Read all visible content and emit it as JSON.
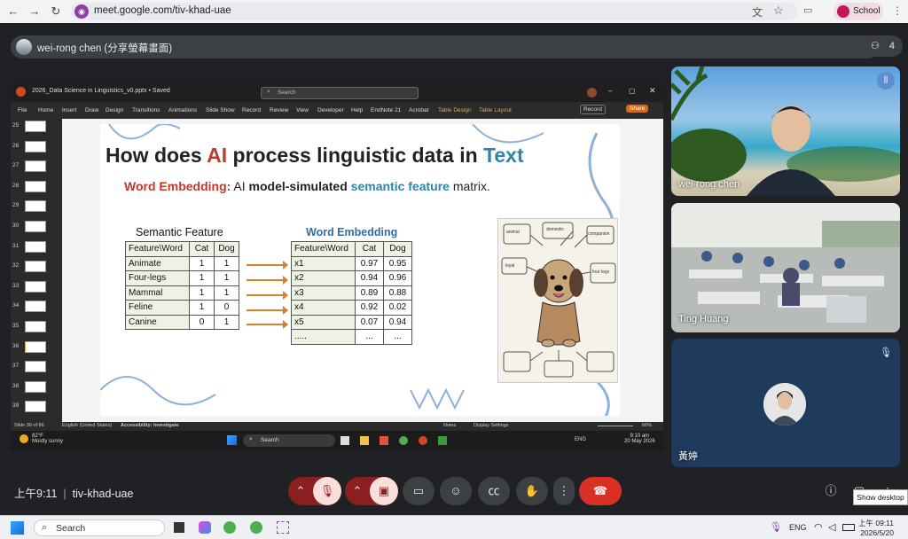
{
  "browser": {
    "url": "meet.google.com/tiv-khad-uae",
    "profile": "School"
  },
  "meet": {
    "presenter_label": "wei-rong chen (分享螢幕畫面)",
    "participant_count": "4",
    "time": "上午9:11",
    "meeting_code": "tiv-khad-uae",
    "tooltip": "Show desktop"
  },
  "participants": [
    {
      "name": "wei-rong chen"
    },
    {
      "name": "Ting Huang"
    },
    {
      "name": "黃婷"
    }
  ],
  "shared": {
    "file": "2026_Data Science in Linguistics_v0.pptx • Saved",
    "search_placeholder": "Search",
    "ribbon": [
      "File",
      "Home",
      "Insert",
      "Draw",
      "Design",
      "Transitions",
      "Animations",
      "Slide Show",
      "Record",
      "Review",
      "View",
      "Developer",
      "Help",
      "EndNote 21",
      "Acrobat",
      "Table Design",
      "Table Layout"
    ],
    "record_label": "Record",
    "share_label": "Share",
    "slide_numbers": [
      "25",
      "26",
      "27",
      "28",
      "29",
      "30",
      "31",
      "32",
      "33",
      "34",
      "35",
      "36",
      "37",
      "38",
      "39"
    ],
    "status": {
      "slide": "Slide 36 of 86",
      "language": "English (United States)",
      "accessibility": "Accessibility: Investigate",
      "notes": "Notes",
      "display": "Display Settings",
      "zoom": "66%"
    },
    "taskbar": {
      "weather_temp": "82°F",
      "weather_desc": "Mostly sunny",
      "search": "Search",
      "lang": "ENG",
      "time": "9:10 am",
      "date": "20 May 2026"
    }
  },
  "slide": {
    "title_pre": "How does ",
    "title_ai": "AI",
    "title_mid": " process linguistic data in ",
    "title_text": "Text",
    "sub_we": "Word Embedding:",
    "sub_pre": "  AI ",
    "sub_bold": "model-simulated",
    "sub_sf": " semantic feature",
    "sub_end": " matrix.",
    "semantic_title": "Semantic Feature",
    "embedding_title": "Word Embedding",
    "semantic_table": [
      [
        "Feature\\Word",
        "Cat",
        "Dog"
      ],
      [
        "Animate",
        "1",
        "1"
      ],
      [
        "Four-legs",
        "1",
        "1"
      ],
      [
        "Mammal",
        "1",
        "1"
      ],
      [
        "Feline",
        "1",
        "0"
      ],
      [
        "Canine",
        "0",
        "1"
      ]
    ],
    "embedding_table": [
      [
        "Feature\\Word",
        "Cat",
        "Dog"
      ],
      [
        "x1",
        "0.97",
        "0.95"
      ],
      [
        "x2",
        "0.94",
        "0.96"
      ],
      [
        "x3",
        "0.89",
        "0.88"
      ],
      [
        "x4",
        "0.92",
        "0.02"
      ],
      [
        "x5",
        "0.07",
        "0.94"
      ],
      [
        ".....",
        "...",
        "..."
      ]
    ],
    "image_labels": [
      "animal",
      "domestic",
      "companion",
      "loyal",
      "four legs"
    ]
  },
  "taskbar": {
    "search": "Search",
    "lang": "ENG",
    "time": "上午 09:11",
    "date": "2026/5/20"
  }
}
